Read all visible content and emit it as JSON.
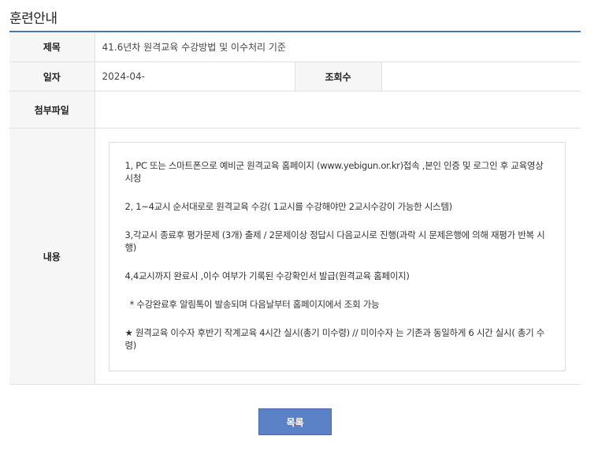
{
  "page": {
    "title": "훈련안내"
  },
  "post": {
    "subject_label": "제목",
    "subject": "41.6년차 원격교육 수강방법 및 이수처리 기준",
    "date_label": "일자",
    "date": "2024-04-",
    "views_label": "조회수",
    "views": "",
    "attachment_label": "첨부파일",
    "attachment": "",
    "content_label": "내용",
    "content": [
      "1, PC 또는 스마트폰으로 예비군 원격교육 홈페이지 (www.yebigun.or.kr)접속 ,본인 인증 및 로그인 후 교육영상 시청",
      "2, 1~4교시 순서대로로 원격교육 수강( 1교시를 수강해야만 2교시수강이 가능한 시스템)",
      "3,각교시 종료후 평가문제 (3개) 출제 / 2문제이상 정답시 다음교시로 진행(과락 시 문제은행에 의해 재평가 반복 시행)",
      "4,4교시까지 완료시 ,이수 여부가 기록된 수강확인서 발급(원격교육 홈페이지)",
      " * 수강완료후 알림톡이 발송되며  다음날부터 홈페이지에서 조회 가능",
      "★ 원격교육 이수자 후반기 작계교육 4시간 실시(총기 미수령) // 미이수자 는 기존과 동일하게 6 시간 실시( 총기 수령)"
    ]
  },
  "buttons": {
    "list_label": "목록"
  },
  "colors": {
    "accent": "#4a76b4",
    "button_bg": "#5b82c6",
    "label_bg": "#f6f6f6"
  }
}
